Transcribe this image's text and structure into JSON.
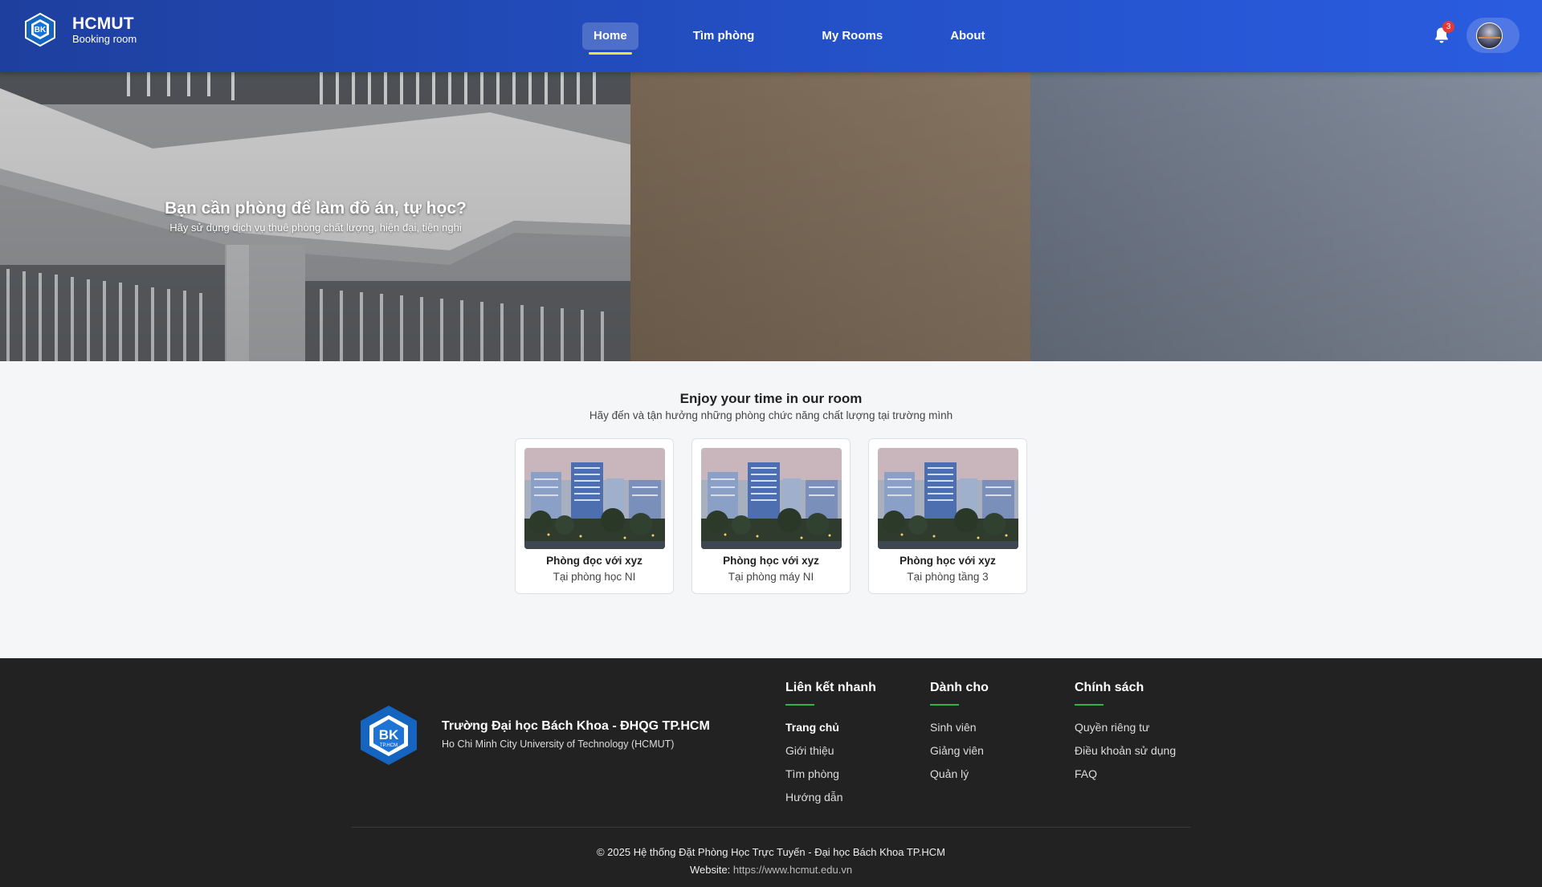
{
  "header": {
    "brand_title": "HCMUT",
    "brand_subtitle": "Booking room",
    "logo_letters": "BK",
    "nav": [
      {
        "label": "Home",
        "active": true
      },
      {
        "label": "Tìm phòng",
        "active": false
      },
      {
        "label": "My Rooms",
        "active": false
      },
      {
        "label": "About",
        "active": false
      }
    ],
    "notification_count": "3",
    "icons": {
      "bell": "bell-icon",
      "avatar": "user-avatar"
    }
  },
  "hero": {
    "title": "Bạn cần phòng để làm đồ án, tự học?",
    "subtitle": "Hãy sử dụng dịch vụ thuê phòng chất lượng, hiện đại, tiện nghi"
  },
  "rooms_section": {
    "title": "Enjoy your time in our room",
    "subtitle": "Hãy đến và tận hưởng những phòng chức năng chất lượng tại trường mình",
    "cards": [
      {
        "title": "Phòng đọc với xyz",
        "location": "Tại phòng học NI"
      },
      {
        "title": "Phòng học với xyz",
        "location": "Tại phòng máy NI"
      },
      {
        "title": "Phòng học với xyz",
        "location": "Tại phòng tầng 3"
      }
    ]
  },
  "footer": {
    "logo_letters": "BK",
    "logo_sub": "TP.HCM",
    "org_name": "Trường Đại học Bách Khoa - ĐHQG TP.HCM",
    "org_name_en": "Ho Chi Minh City University of Technology (HCMUT)",
    "columns": [
      {
        "heading": "Liên kết nhanh",
        "links": [
          "Trang chủ",
          "Giới thiệu",
          "Tìm phòng",
          "Hướng dẫn"
        ]
      },
      {
        "heading": "Dành cho",
        "links": [
          "Sinh viên",
          "Giảng viên",
          "Quản lý"
        ]
      },
      {
        "heading": "Chính sách",
        "links": [
          "Quyền riêng tư",
          "Điều khoản sử dụng",
          "FAQ"
        ]
      }
    ],
    "copyright": "© 2025 Hệ thống Đặt Phòng Học Trực Tuyến - Đại học Bách Khoa TP.HCM",
    "website_label": "Website:",
    "website_url": "https://www.hcmut.edu.vn"
  },
  "colors": {
    "header_start": "#1e3f9e",
    "header_end": "#2a5ce0",
    "active_underline": "#f2e33a",
    "badge": "#e53935",
    "footer_bg": "#222222",
    "footer_accent": "#2fb34f"
  }
}
